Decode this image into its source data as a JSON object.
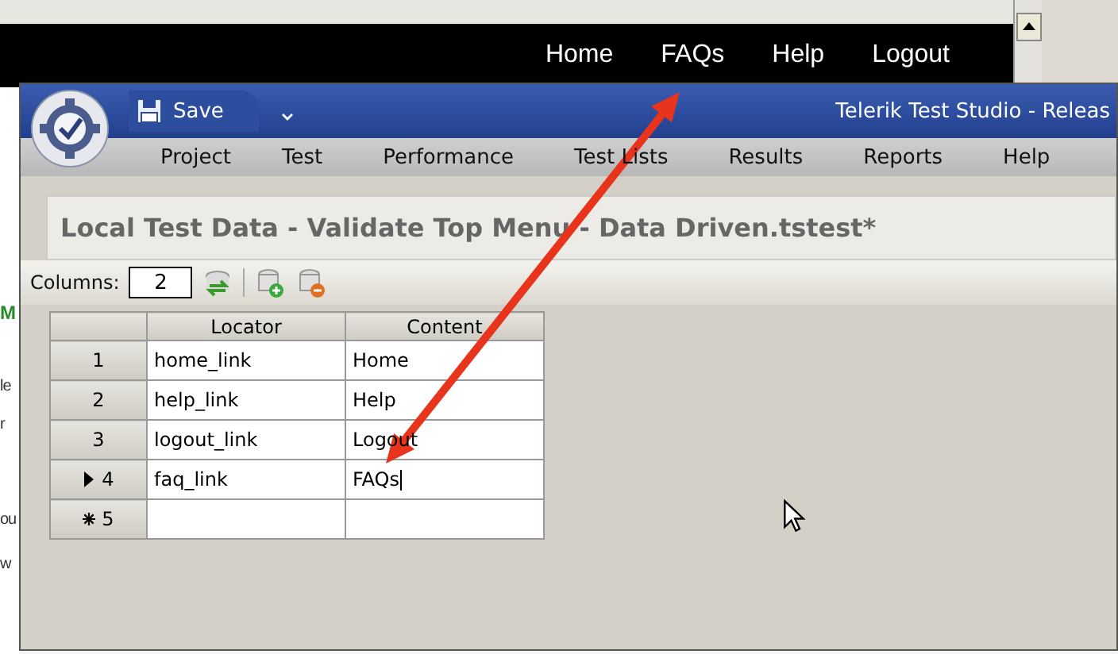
{
  "browser": {
    "nav_links": [
      "Home",
      "FAQs",
      "Help",
      "Logout"
    ],
    "page_fragments": [
      {
        "text": "M",
        "kind": "heading"
      },
      {
        "text": "le",
        "kind": "body"
      },
      {
        "text": "r",
        "kind": "body"
      },
      {
        "text": "ou",
        "kind": "body"
      },
      {
        "text": "w",
        "kind": "body"
      }
    ]
  },
  "window": {
    "title": "Telerik Test Studio - Releas",
    "save": "Save"
  },
  "menu": [
    "Project",
    "Test",
    "Performance",
    "Test Lists",
    "Results",
    "Reports",
    "Help"
  ],
  "document_title": "Local Test Data - Validate Top Menu - Data Driven.tstest*",
  "toolbar": {
    "columns_label": "Columns:",
    "columns_value": "2"
  },
  "grid": {
    "columns": [
      "Locator",
      "Content"
    ],
    "rows": [
      {
        "kind": "data",
        "number": "1",
        "locator": "home_link",
        "content": "Home",
        "current": false
      },
      {
        "kind": "data",
        "number": "2",
        "locator": "help_link",
        "content": "Help",
        "current": false
      },
      {
        "kind": "data",
        "number": "3",
        "locator": "logout_link",
        "content": "Logout",
        "current": false
      },
      {
        "kind": "data",
        "number": "4",
        "locator": "faq_link",
        "content": "FAQs",
        "current": true
      },
      {
        "kind": "new",
        "number": "5",
        "locator": "",
        "content": "",
        "current": false
      }
    ]
  }
}
